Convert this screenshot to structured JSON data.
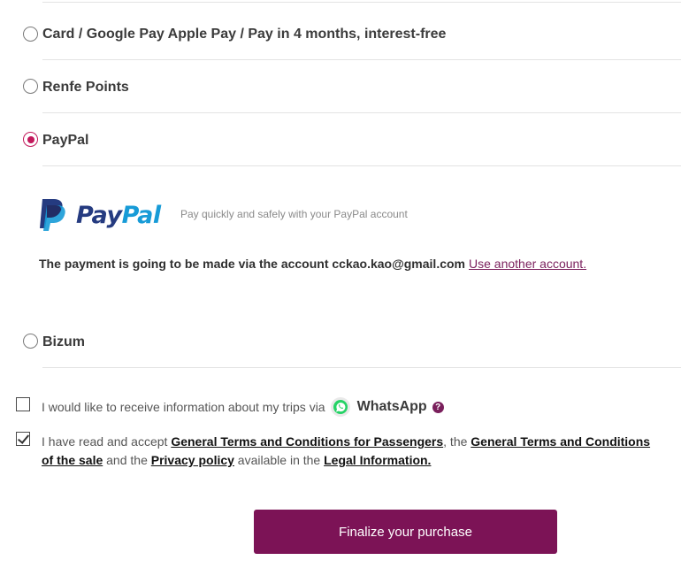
{
  "payment_options": [
    {
      "label": "Card / Google Pay Apple Pay / Pay in 4 months, interest-free",
      "selected": false
    },
    {
      "label": "Renfe Points",
      "selected": false
    },
    {
      "label": "PayPal",
      "selected": true
    },
    {
      "label": "Bizum",
      "selected": false
    }
  ],
  "paypal": {
    "logo_pay": "Pay",
    "logo_pal": "Pal",
    "description": "Pay quickly and safely with your PayPal account",
    "account_text": "The payment is going to be made via the account cckao.kao@gmail.com",
    "another_account_link": "Use another account."
  },
  "whatsapp_opt_in": {
    "checked": false,
    "text": "I would like to receive information about my trips via",
    "brand": "WhatsApp",
    "help_glyph": "?"
  },
  "terms": {
    "checked": true,
    "part1": "I have read and accept ",
    "link1": "General Terms and Conditions for Passengers",
    "part2": ", the ",
    "link2": "General Terms and Conditions of the sale",
    "part3": " and the ",
    "link3": "Privacy policy",
    "part4": " available in the ",
    "link4": "Legal Information."
  },
  "finalize_label": "Finalize your purchase",
  "colors": {
    "accent": "#7c1356",
    "radio_selected": "#c2185b",
    "paypal_dark": "#253b80",
    "paypal_light": "#179bd7",
    "whatsapp_green": "#25d366"
  },
  "icons": [
    "paypal-logo-icon",
    "whatsapp-icon",
    "help-icon",
    "checkmark-icon"
  ]
}
